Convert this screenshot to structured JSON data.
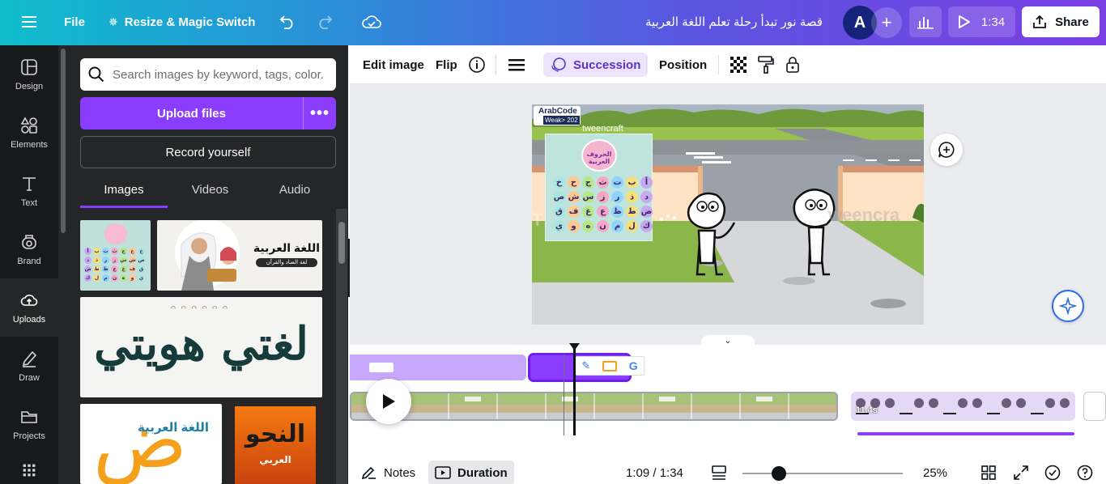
{
  "topbar": {
    "file_label": "File",
    "resize_label": "Resize & Magic Switch",
    "design_title": "قصة نور تبدأ رحلة تعلم اللغة العربية",
    "avatar_initial": "A",
    "play_duration": "1:34",
    "share_label": "Share"
  },
  "rail": {
    "items": [
      {
        "label": "Design",
        "icon": "layout-icon"
      },
      {
        "label": "Elements",
        "icon": "shapes-icon"
      },
      {
        "label": "Text",
        "icon": "text-t-icon"
      },
      {
        "label": "Brand",
        "icon": "crown-icon"
      },
      {
        "label": "Uploads",
        "icon": "cloud-upload-icon"
      },
      {
        "label": "Draw",
        "icon": "pen-icon"
      },
      {
        "label": "Projects",
        "icon": "folder-icon"
      }
    ]
  },
  "panel": {
    "search_placeholder": "Search images by keyword, tags, color...",
    "upload_label": "Upload files",
    "record_label": "Record yourself",
    "tabs": [
      {
        "label": "Images",
        "active": true
      },
      {
        "label": "Videos",
        "active": false
      },
      {
        "label": "Audio",
        "active": false
      }
    ],
    "thumb_texts": {
      "arabic_lang": "اللغة العربية",
      "arabic_lang_sub": "لغة الضاد والقرآن",
      "calligraphy": "لغتي هويتي",
      "dad_letter": "ض",
      "dad_arc": "اللغة العربية",
      "nahw": "النحو",
      "nahw_sub": "العربي"
    }
  },
  "toolbar": {
    "edit_image": "Edit image",
    "flip": "Flip",
    "succession": "Succession",
    "position": "Position"
  },
  "canvas": {
    "logo_top": "ArabCode",
    "logo_bottom": "Weak> 202",
    "tweencraft": "tweencraft",
    "watermark_right": "weencra",
    "alphabet_title": "الحروف العربية",
    "letters": [
      "أ",
      "ب",
      "ت",
      "ث",
      "ج",
      "ح",
      "خ",
      "د",
      "ذ",
      "ر",
      "ز",
      "س",
      "ش",
      "ص",
      "ض",
      "ط",
      "ظ",
      "ع",
      "غ",
      "ف",
      "ق",
      "ك",
      "ل",
      "م",
      "ن",
      "ه",
      "و",
      "ي"
    ]
  },
  "timeline": {
    "clip_duration": "11.4s"
  },
  "bottom": {
    "notes_label": "Notes",
    "duration_label": "Duration",
    "time_readout": "1:09 / 1:34",
    "zoom_level": "25%"
  },
  "colors": {
    "accent": "#8b3dff",
    "rail_bg": "#18191b",
    "panel_bg": "#252627"
  }
}
